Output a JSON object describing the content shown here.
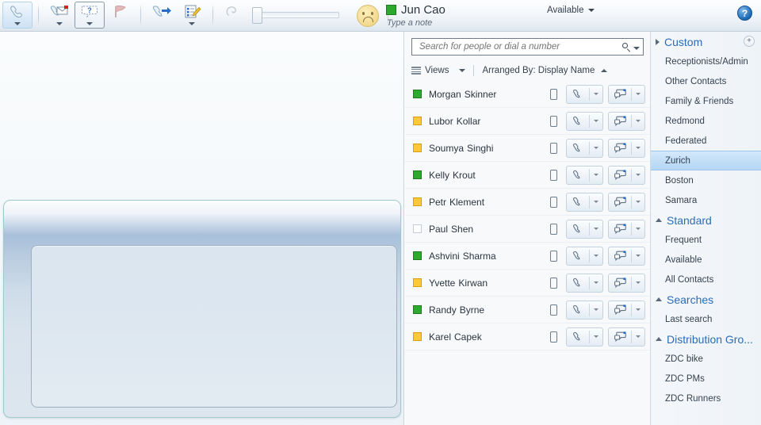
{
  "toolbar": {
    "buttons": [
      {
        "name": "call-button",
        "icon": "phone-icon",
        "state": "hover",
        "caret": true
      },
      {
        "name": "voicemail-button",
        "icon": "voicemail-icon",
        "state": "normal",
        "caret": true
      },
      {
        "name": "instant-message-button",
        "icon": "im-question-icon",
        "state": "pressed",
        "caret": true
      },
      {
        "name": "flag-button",
        "icon": "flag-icon",
        "state": "normal",
        "caret": false
      },
      {
        "name": "forward-call-button",
        "icon": "call-forward-icon",
        "state": "normal",
        "caret": false
      },
      {
        "name": "notes-button",
        "icon": "notes-edit-icon",
        "state": "normal",
        "caret": true
      },
      {
        "name": "headset-button",
        "icon": "headset-icon",
        "state": "disabled",
        "caret": false
      },
      {
        "name": "audio-device-button",
        "icon": "phone-device-icon",
        "state": "normal",
        "caret": true
      }
    ],
    "volume_slider": {
      "name": "volume-slider",
      "value": 0
    }
  },
  "header": {
    "avatar": "smiley-sad-avatar",
    "presence_color": "#2fa82f",
    "display_name": "Jun Cao",
    "note_placeholder": "Type a note",
    "availability_label": "Available",
    "help_label": "?"
  },
  "search": {
    "placeholder": "Search for people or dial a number",
    "value": ""
  },
  "filters": {
    "views_label": "Views",
    "arranged_by_label": "Arranged By: Display Name"
  },
  "contacts": [
    {
      "first": "Morgan",
      "last": "Skinner",
      "presence": "available",
      "mobile": true
    },
    {
      "first": "Lubor",
      "last": "Kollar",
      "presence": "away",
      "mobile": true
    },
    {
      "first": "Soumya",
      "last": "Singhi",
      "presence": "away",
      "mobile": true
    },
    {
      "first": "Kelly",
      "last": "Krout",
      "presence": "available",
      "mobile": true
    },
    {
      "first": "Petr",
      "last": "Klement",
      "presence": "away",
      "mobile": true
    },
    {
      "first": "Paul",
      "last": "Shen",
      "presence": "offline",
      "mobile": true
    },
    {
      "first": "Ashvini",
      "last": "Sharma",
      "presence": "available",
      "mobile": true
    },
    {
      "first": "Yvette",
      "last": "Kirwan",
      "presence": "away",
      "mobile": true
    },
    {
      "first": "Randy",
      "last": "Byrne",
      "presence": "available",
      "mobile": true
    },
    {
      "first": "Karel",
      "last": "Capek",
      "presence": "away",
      "mobile": true
    }
  ],
  "contact_actions": {
    "call_label": "call-icon",
    "im_label": "im-icon"
  },
  "sidebar": {
    "groups": [
      {
        "title": "Custom",
        "expanded": false,
        "has_add": true,
        "add_label": "+",
        "items": [
          {
            "label": "Receptionists/Admin",
            "selected": false
          },
          {
            "label": "Other Contacts",
            "selected": false
          },
          {
            "label": "Family & Friends",
            "selected": false
          },
          {
            "label": "Redmond",
            "selected": false
          },
          {
            "label": "Federated",
            "selected": false
          },
          {
            "label": "Zurich",
            "selected": true
          },
          {
            "label": "Boston",
            "selected": false
          },
          {
            "label": "Samara",
            "selected": false
          }
        ]
      },
      {
        "title": "Standard",
        "expanded": true,
        "has_add": false,
        "items": [
          {
            "label": "Frequent",
            "selected": false
          },
          {
            "label": "Available",
            "selected": false
          },
          {
            "label": "All Contacts",
            "selected": false
          }
        ]
      },
      {
        "title": "Searches",
        "expanded": true,
        "has_add": false,
        "items": [
          {
            "label": "Last search",
            "selected": false
          }
        ]
      },
      {
        "title": "Distribution Gro...",
        "expanded": true,
        "has_add": false,
        "items": [
          {
            "label": "ZDC bike",
            "selected": false
          },
          {
            "label": "ZDC PMs",
            "selected": false
          },
          {
            "label": "ZDC Runners",
            "selected": false
          }
        ]
      }
    ]
  },
  "colors": {
    "accent": "#2b6cb8",
    "available": "#2fa82f",
    "away": "#ffc83c",
    "offline": "#ffffff",
    "selection": "#c2dff8"
  }
}
